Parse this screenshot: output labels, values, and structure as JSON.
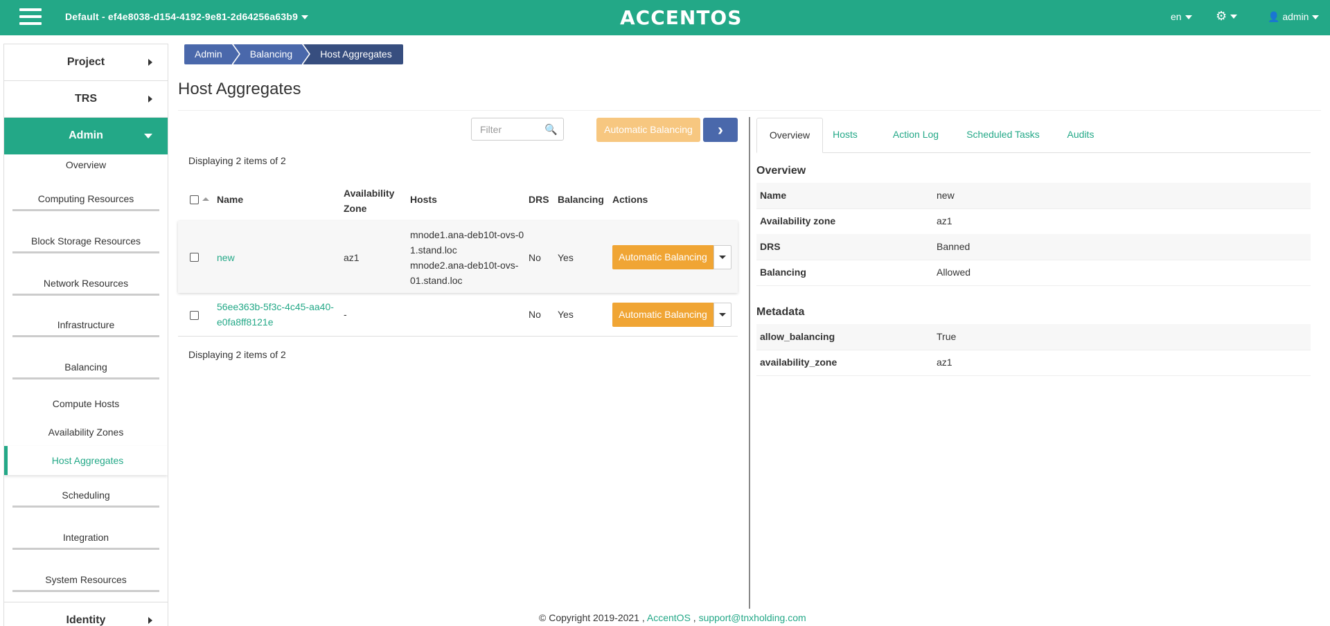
{
  "header": {
    "project_selector": "Default - ef4e8038-d154-4192-9e81-2d64256a63b9",
    "logo": "ACCENTOS",
    "language": "en",
    "user": "admin",
    "brand_color": "#23a887"
  },
  "sidebar": {
    "sections": [
      {
        "label": "Project"
      },
      {
        "label": "TRS"
      },
      {
        "label": "Admin"
      }
    ],
    "admin_items": [
      "Overview",
      "Computing Resources",
      "Block Storage Resources",
      "Network Resources",
      "Infrastructure",
      "Balancing",
      "Compute Hosts",
      "Availability Zones",
      "Host Aggregates",
      "Scheduling",
      "Integration",
      "System Resources"
    ],
    "identity": "Identity"
  },
  "breadcrumb": [
    "Admin",
    "Balancing",
    "Host Aggregates"
  ],
  "page_title": "Host Aggregates",
  "table": {
    "filter_placeholder": "Filter",
    "auto_balancing_button": "Automatic Balancing",
    "display_count": "Displaying 2 items of 2",
    "columns": [
      "Name",
      "Availability Zone",
      "Hosts",
      "DRS",
      "Balancing",
      "Actions"
    ],
    "rows": [
      {
        "name": "new",
        "zone": "az1",
        "hosts": [
          "mnode1.ana-deb10t-ovs-0",
          "1.stand.loc",
          "mnode2.ana-deb10t-ovs-",
          "01.stand.loc"
        ],
        "drs": "No",
        "balancing": "Yes",
        "action": "Automatic Balancing"
      },
      {
        "name_line1": "56ee363b-5f3c-4c45-aa40-",
        "name_line2": "e0fa8ff8121e",
        "zone": "-",
        "drs": "No",
        "balancing": "Yes",
        "action": "Automatic Balancing"
      }
    ]
  },
  "details": {
    "tabs": [
      "Overview",
      "Hosts",
      "Action Log",
      "Scheduled Tasks",
      "Audits"
    ],
    "overview_heading": "Overview",
    "overview": [
      {
        "key": "Name",
        "value": "new"
      },
      {
        "key": "Availability zone",
        "value": "az1"
      },
      {
        "key": "DRS",
        "value": "Banned"
      },
      {
        "key": "Balancing",
        "value": "Allowed"
      }
    ],
    "metadata_heading": "Metadata",
    "metadata": [
      {
        "key": "allow_balancing",
        "value": "True"
      },
      {
        "key": "availability_zone",
        "value": "az1"
      }
    ]
  },
  "footer": {
    "copyright": "© Copyright 2019-2021 ,",
    "brand_link": "AccentOS",
    "separator": ",",
    "email": "support@tnxholding.com"
  }
}
